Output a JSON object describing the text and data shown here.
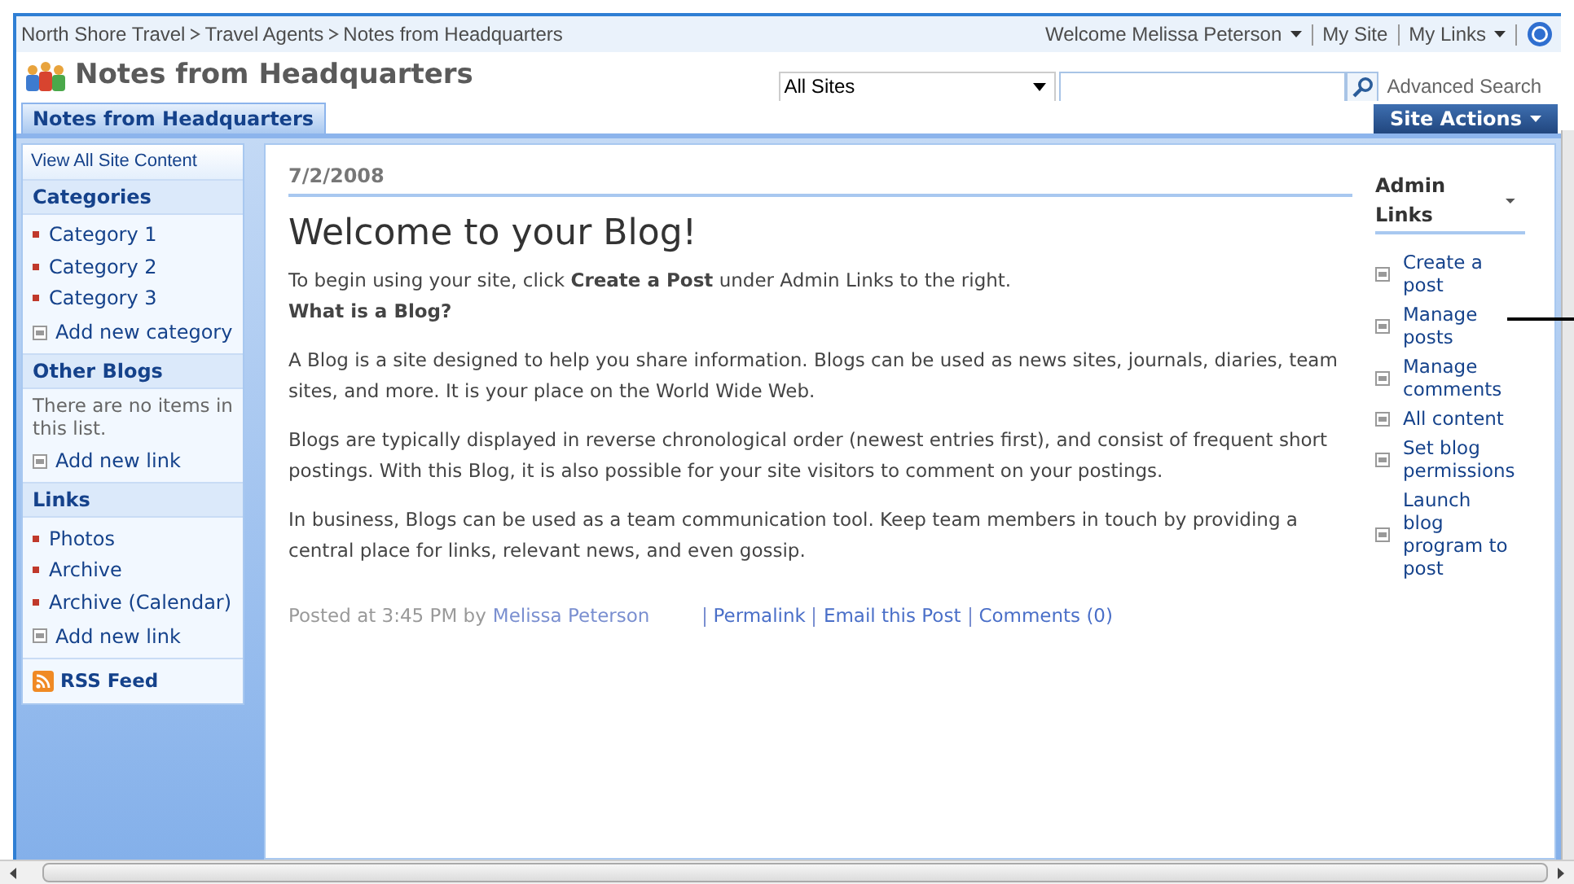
{
  "breadcrumb": [
    "North Shore Travel",
    "Travel Agents",
    "Notes from Headquarters"
  ],
  "user_menu": {
    "welcome": "Welcome Melissa Peterson",
    "links": [
      {
        "label": "My Site",
        "dropdown": false
      },
      {
        "label": "My Links",
        "dropdown": true
      }
    ]
  },
  "site_title": "Notes from Headquarters",
  "search": {
    "scope": "All Sites",
    "advanced": "Advanced Search"
  },
  "tabs": [
    {
      "label": "Notes from Headquarters",
      "selected": true
    }
  ],
  "site_actions": "Site Actions",
  "quick_launch": {
    "top_link": "View All Site Content",
    "sections": [
      {
        "title": "Categories",
        "items": [
          {
            "label": "Category 1",
            "kind": "bullet"
          },
          {
            "label": "Category 2",
            "kind": "bullet"
          },
          {
            "label": "Category 3",
            "kind": "bullet"
          },
          {
            "label": "Add new category",
            "kind": "add"
          }
        ]
      },
      {
        "title": "Other Blogs",
        "items": [
          {
            "label": "There are no items in this list.",
            "kind": "note"
          },
          {
            "label": "Add new link",
            "kind": "add"
          }
        ]
      },
      {
        "title": "Links",
        "items": [
          {
            "label": "Photos",
            "kind": "bullet"
          },
          {
            "label": "Archive",
            "kind": "bullet"
          },
          {
            "label": "Archive (Calendar)",
            "kind": "bullet"
          },
          {
            "label": "Add new link",
            "kind": "add"
          }
        ]
      }
    ],
    "rss": "RSS Feed"
  },
  "post": {
    "date": "7/2/2008",
    "title": "Welcome to your Blog!",
    "paragraphs": [
      {
        "kind": "intro",
        "text": "To begin using your site, click **Create a Post** under Admin Links to the right."
      },
      {
        "kind": "heading",
        "text": "What is a Blog?"
      },
      {
        "kind": "text",
        "text": "A Blog is a site designed to help you share information. Blogs can be used as news sites, journals, diaries, team sites, and more. It is your place on the World Wide Web."
      },
      {
        "kind": "text",
        "text": "Blogs are typically displayed in reverse chronological order (newest entries first), and consist of frequent short postings. With this Blog, it is also possible for your site visitors to comment on your postings."
      },
      {
        "kind": "text",
        "text": "In business, Blogs can be used as a team communication tool. Keep team members in touch by providing a central place for links, relevant news, and even gossip."
      }
    ],
    "posted": "Posted at 3:45 PM by",
    "author": "Melissa Peterson",
    "actions": [
      "Permalink",
      "Email this Post",
      "Comments (0)"
    ]
  },
  "admin_links": {
    "title": "Admin Links",
    "items": [
      "Create a post",
      "Manage posts",
      "Manage comments",
      "All content",
      "Set blog permissions",
      "Launch blog program to post"
    ]
  }
}
